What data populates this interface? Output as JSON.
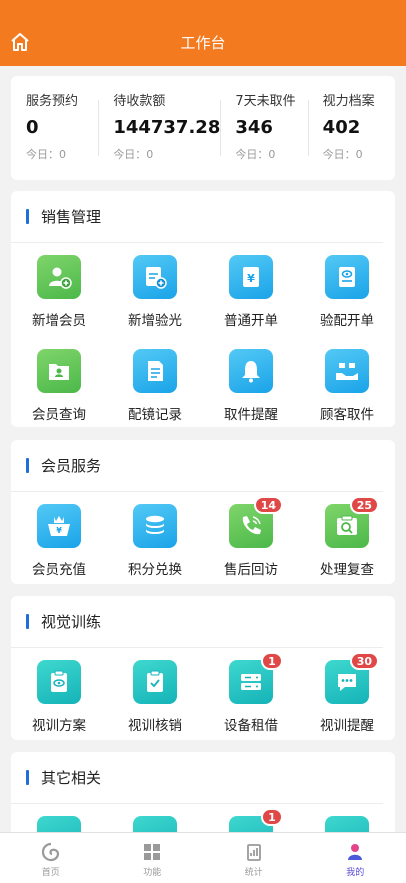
{
  "header": {
    "title": "工作台",
    "icon": "home-icon"
  },
  "stats": [
    {
      "label": "服务预约",
      "value": "0",
      "today": "今日：0"
    },
    {
      "label": "待收款额",
      "value": "144737.28",
      "today": "今日：0"
    },
    {
      "label": "7天未取件",
      "value": "346",
      "today": "今日：0"
    },
    {
      "label": "视力档案",
      "value": "402",
      "today": "今日：0"
    }
  ],
  "sections": {
    "sales": {
      "title": "销售管理",
      "items": [
        {
          "label": "新增会员",
          "icon": "add-member-icon"
        },
        {
          "label": "新增验光",
          "icon": "add-optometry-icon"
        },
        {
          "label": "普通开单",
          "icon": "normal-order-icon"
        },
        {
          "label": "验配开单",
          "icon": "fitting-order-icon"
        },
        {
          "label": "会员查询",
          "icon": "member-query-icon"
        },
        {
          "label": "配镜记录",
          "icon": "glasses-record-icon"
        },
        {
          "label": "取件提醒",
          "icon": "pickup-reminder-icon"
        },
        {
          "label": "顾客取件",
          "icon": "customer-pickup-icon"
        }
      ]
    },
    "member": {
      "title": "会员服务",
      "items": [
        {
          "label": "会员充值",
          "icon": "member-recharge-icon"
        },
        {
          "label": "积分兑换",
          "icon": "points-exchange-icon"
        },
        {
          "label": "售后回访",
          "icon": "aftersales-call-icon",
          "badge": "14"
        },
        {
          "label": "处理复查",
          "icon": "recheck-icon",
          "badge": "25"
        }
      ]
    },
    "vision": {
      "title": "视觉训练",
      "items": [
        {
          "label": "视训方案",
          "icon": "training-plan-icon"
        },
        {
          "label": "视训核销",
          "icon": "training-verify-icon"
        },
        {
          "label": "设备租借",
          "icon": "device-rental-icon",
          "badge": "1"
        },
        {
          "label": "视训提醒",
          "icon": "training-reminder-icon",
          "badge": "30"
        }
      ]
    },
    "other": {
      "title": "其它相关",
      "items": [
        {
          "icon": "other-icon-1"
        },
        {
          "icon": "other-icon-2"
        },
        {
          "icon": "other-icon-3",
          "badge": "1"
        },
        {
          "icon": "other-icon-4"
        }
      ]
    }
  },
  "tabbar": [
    {
      "label": "首页",
      "icon": "home-tab-icon"
    },
    {
      "label": "功能",
      "icon": "functions-tab-icon"
    },
    {
      "label": "统计",
      "icon": "statistics-tab-icon"
    },
    {
      "label": "我的",
      "icon": "profile-tab-icon",
      "active": true
    }
  ],
  "colors": {
    "header": "#f47a20",
    "accent_bar": "#1e6fd9",
    "badge": "#e04848",
    "active_tab": "#5a4bd8"
  }
}
